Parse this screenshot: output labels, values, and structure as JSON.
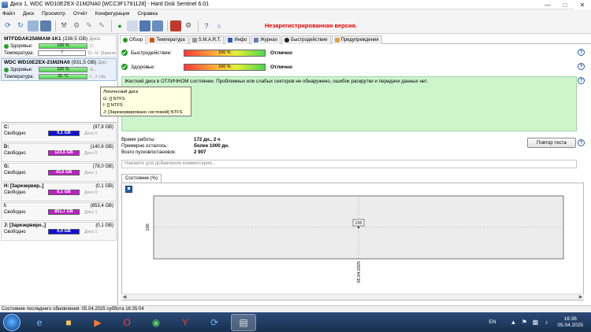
{
  "window": {
    "title": "Диск 1, WDC WD10EZEX-21M2NA0 [WCC3F1791128] - Hard Disk Sentinel 6.01"
  },
  "menu": [
    "Файл",
    "Диск",
    "Просмотр",
    "Отчёт",
    "Конфигурация",
    "Справка"
  ],
  "toolbar": {
    "unregistered": "Незарегистрированная версия."
  },
  "disks": [
    {
      "name": "MTFDDAK256MAM-1K1",
      "size": "(238,5 GB)",
      "size_suffix": "Диск",
      "health_label": "Здоровье:",
      "health_value": "100 %",
      "health_drive": "C:",
      "temp_label": "Температура:",
      "temp_value": "?",
      "temp_drives": "D:, H: [Зарезе"
    },
    {
      "name": "WDC WD10EZEX-21M2NA0",
      "size": "(931,5 GB)",
      "size_suffix": "Дис",
      "health_label": "Здоровье:",
      "health_value": "100 %",
      "health_drive": "G:,",
      "temp_label": "Температура:",
      "temp_value": "25 °C",
      "temp_drives": "I:, J: [За"
    }
  ],
  "volumes": [
    {
      "name": "C:",
      "size": "(97,8 GB)",
      "free_label": "Свободно",
      "free": "9,1 GB",
      "free_color": "#1010d8",
      "disk": "Диск 0"
    },
    {
      "name": "D:",
      "size": "(140,6 GB)",
      "free_label": "Свободно",
      "free": "123,6 GB",
      "free_color": "#c020c8",
      "disk": "Диск 0"
    },
    {
      "name": "G:",
      "size": "(78,0 GB)",
      "free_label": "Свободно",
      "free": "43,6 GB",
      "free_color": "#c020c8",
      "disk": "Диск 1"
    },
    {
      "name": "H: [Зарезервир..]",
      "size": "(0,1 GB)",
      "free_label": "Свободно",
      "free": "0,1 GB",
      "free_color": "#c020c8",
      "disk": "Диск 0"
    },
    {
      "name": "I:",
      "size": "(853,4 GB)",
      "free_label": "Свободно",
      "free": "851,7 GB",
      "free_color": "#c020c8",
      "disk": "Диск 1"
    },
    {
      "name": "J: [Зарезервиро..]",
      "size": "(0,1 GB)",
      "free_label": "Свободно",
      "free": "0,0 GB",
      "free_color": "#1010d8",
      "disk": "Диск 1"
    }
  ],
  "tooltip": {
    "line1": "Логический диск",
    "line2": "G: [] NTFS",
    "line3": "I: [] NTFS",
    "line4": "J: [Зарезервировано системой] NTFS"
  },
  "tabs": [
    "Обзор",
    "Температура",
    "S.M.A.R.T.",
    "Инфо",
    "Журнал",
    "Быстродействие",
    "Предупреждения"
  ],
  "overview": {
    "performance_label": "Быстродействие:",
    "performance_value": "100 %",
    "performance_status": "Отлично",
    "health_label": "Здоровье:",
    "health_value": "100 %",
    "health_status": "Отлично",
    "summary": "Жесткий диск в ОТЛИЧНОМ состоянии. Проблемных или слабых секторов не обнаружено, ошибок раскрутки и передачи данных нет.",
    "uptime_label": "Время работы:",
    "uptime_value": "172 дн., 2 ч",
    "remaining_label": "Примерно осталось:",
    "remaining_value": "более 1000 дн.",
    "starts_label": "Всего пусков/остановок:",
    "starts_value": "2 907",
    "retest_button": "Повтор теста",
    "comment_placeholder": "Нажмите для добавления комментария..."
  },
  "chart_tab": "Состояние (%)",
  "chart_data": {
    "type": "line",
    "x": [
      "05.04.2025"
    ],
    "series": [
      {
        "values": [
          100
        ]
      }
    ],
    "ylabel": "100",
    "xlabel": "05.04.2025",
    "data_labels": [
      "100"
    ]
  },
  "statusbar": {
    "text": "Состояние последнего обновления: 05.04.2025 суббота 16:35:04"
  },
  "taskbar": {
    "lang": "EN",
    "time": "16:36",
    "date": "05.04.2025"
  },
  "colors": {
    "ok_green": "#1f9d1f",
    "summary_bg": "#ccf5cc",
    "unregistered_red": "#e00000"
  }
}
